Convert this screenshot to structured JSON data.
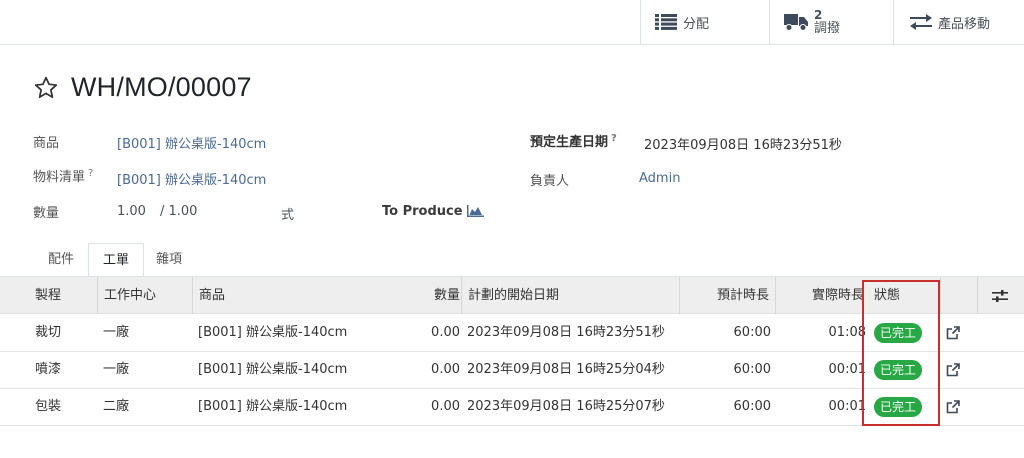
{
  "smart_buttons": {
    "allocation_label": "分配",
    "transfers_count": "2",
    "transfers_label": "調撥",
    "product_moves_label": "產品移動"
  },
  "record": {
    "title": "WH/MO/00007"
  },
  "fields": {
    "product_label": "商品",
    "product_value": "[B001] 辦公桌版-140cm",
    "bom_label": "物料清單",
    "bom_help": "?",
    "bom_value": "[B001] 辦公桌版-140cm",
    "qty_label": "數量",
    "qty_value": "1.00",
    "qty_total": "/ 1.00",
    "uom": "式",
    "to_produce": "To Produce",
    "planned_date_label": "預定生產日期",
    "planned_date_help": "?",
    "planned_date_value": "2023年09月08日 16時23分51秒",
    "responsible_label": "負責人",
    "responsible_value": "Admin"
  },
  "tabs": [
    {
      "label": "配件"
    },
    {
      "label": "工單"
    },
    {
      "label": "雜項"
    }
  ],
  "table": {
    "headers": {
      "operation": "製程",
      "workcenter": "工作中心",
      "product": "商品",
      "qty": "數量",
      "start": "計劃的開始日期",
      "expected": "預計時長",
      "real": "實際時長",
      "status": "狀態"
    },
    "rows": [
      {
        "operation": "裁切",
        "workcenter": "一廠",
        "product": "[B001] 辦公桌版-140cm",
        "qty": "0.00",
        "start": "2023年09月08日 16時23分51秒",
        "expected": "60:00",
        "real": "01:08",
        "status": "已完工"
      },
      {
        "operation": "噴漆",
        "workcenter": "一廠",
        "product": "[B001] 辦公桌版-140cm",
        "qty": "0.00",
        "start": "2023年09月08日 16時25分04秒",
        "expected": "60:00",
        "real": "00:01",
        "status": "已完工"
      },
      {
        "operation": "包裝",
        "workcenter": "二廠",
        "product": "[B001] 辦公桌版-140cm",
        "qty": "0.00",
        "start": "2023年09月08日 16時25分07秒",
        "expected": "60:00",
        "real": "00:01",
        "status": "已完工"
      }
    ]
  },
  "colors": {
    "status_done": "#28a745",
    "highlight_box": "#c9302c",
    "link": "#4b6a96"
  }
}
